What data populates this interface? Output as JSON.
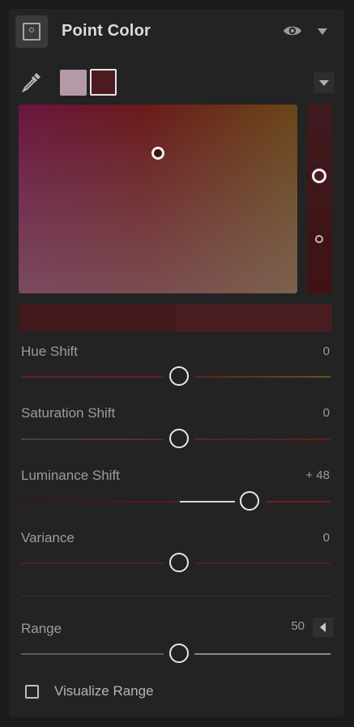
{
  "header": {
    "title": "Point Color",
    "icon": "point-color-icon"
  },
  "toolbar": {
    "swatch_colors": [
      "#b39aa6",
      "#4d1a20"
    ],
    "selected_swatch": 1
  },
  "sliders": [
    {
      "label": "Hue Shift",
      "value": "0"
    },
    {
      "label": "Saturation Shift",
      "value": "0"
    },
    {
      "label": "Luminance Shift",
      "value": "+ 48"
    },
    {
      "label": "Variance",
      "value": "0"
    }
  ],
  "range": {
    "label": "Range",
    "value": "50"
  },
  "visualize": {
    "label": "Visualize Range",
    "checked": false
  },
  "colors": {
    "panel": "#232323",
    "preview_before": "#43191d",
    "preview_after": "#4a1d22"
  }
}
